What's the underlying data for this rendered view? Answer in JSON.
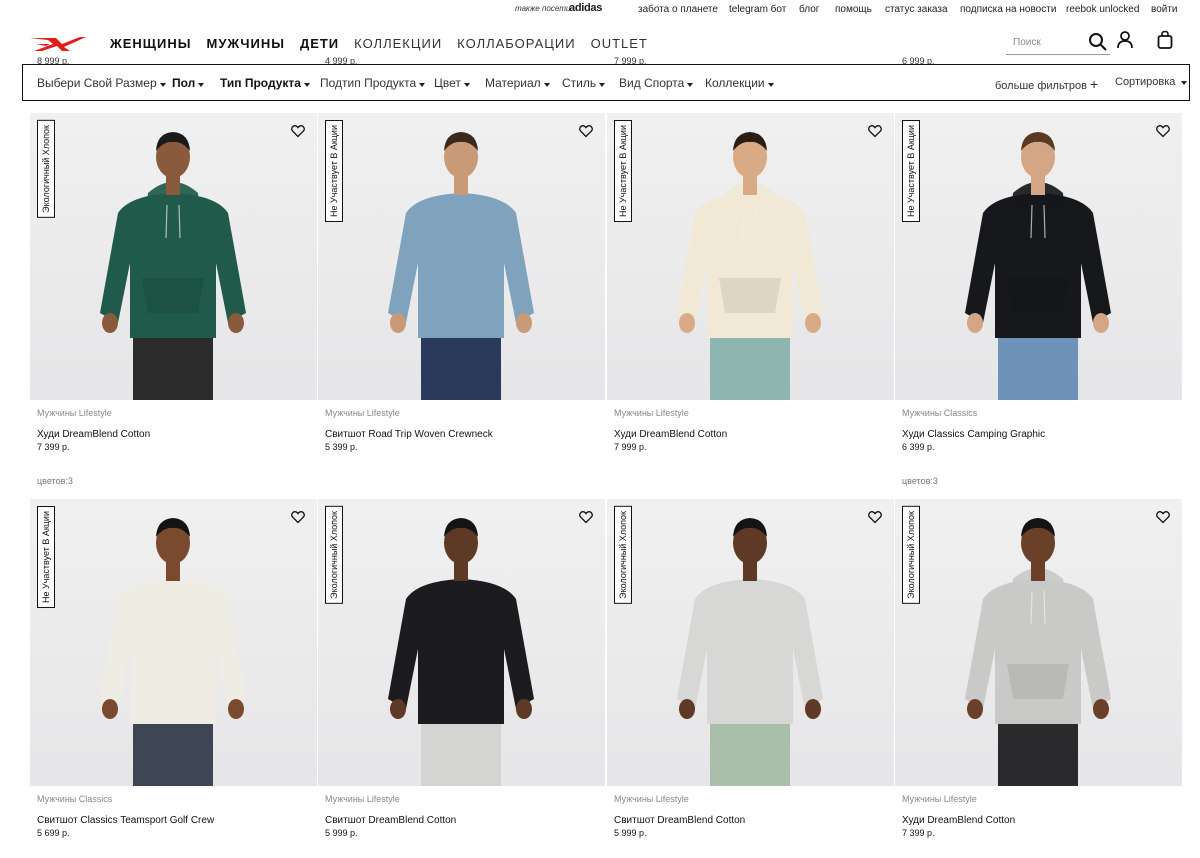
{
  "utility_bar": {
    "also_visit": "также посети",
    "adidas": "adidas",
    "links": [
      "забота о планете",
      "telegram бот",
      "блог",
      "помощь",
      "статус заказа",
      "подписка на новости",
      "reebok unlocked",
      "войти"
    ]
  },
  "header": {
    "nav": [
      {
        "label": "ЖЕНЩИНЫ",
        "bold": true
      },
      {
        "label": "МУЖЧИНЫ",
        "bold": true
      },
      {
        "label": "ДЕТИ",
        "bold": true
      },
      {
        "label": "КОЛЛЕКЦИИ",
        "bold": false
      },
      {
        "label": "КОЛЛАБОРАЦИИ",
        "bold": false
      },
      {
        "label": "OUTLET",
        "bold": false
      }
    ],
    "search_placeholder": "Поиск",
    "ghost_prices": [
      "8 999 р.",
      "4 999 р.",
      "7 999 р.",
      "6 999 р."
    ]
  },
  "filters": {
    "items": [
      {
        "label": "Выбери Свой Размер",
        "bold": false
      },
      {
        "label": "Пол",
        "bold": true
      },
      {
        "label": "Тип Продукта",
        "bold": true
      },
      {
        "label": "Подтип Продукта",
        "bold": false
      },
      {
        "label": "Цвет",
        "bold": false
      },
      {
        "label": "Материал",
        "bold": false
      },
      {
        "label": "Стиль",
        "bold": false
      },
      {
        "label": "Вид Спорта",
        "bold": false
      },
      {
        "label": "Коллекции",
        "bold": false
      }
    ],
    "more_filters": "больше фильтров",
    "more_icon": "+",
    "sort": "Сортировка"
  },
  "products": [
    {
      "badge": "Экологичный Хлопок",
      "category": "Мужчины Lifestyle",
      "name": "Худи DreamBlend Cotton",
      "price": "7 399 р.",
      "colors": "цветов:3",
      "top_color": "#1f5a4a",
      "bottom_color": "#2b2b2b",
      "top_type": "hoodie",
      "skin": "#8a5a3c",
      "hair": "#1a1a1a"
    },
    {
      "badge": "Не Участвует В Акции",
      "category": "Мужчины Lifestyle",
      "name": "Свитшот Road Trip Woven Crewneck",
      "price": "5 399 р.",
      "colors": "",
      "top_color": "#7fa3bd",
      "bottom_color": "#2a3a5c",
      "top_type": "crew",
      "skin": "#c89a78",
      "hair": "#3a2a1e"
    },
    {
      "badge": "Не Участвует В Акции",
      "category": "Мужчины Lifestyle",
      "name": "Худи DreamBlend Cotton",
      "price": "7 999 р.",
      "colors": "",
      "top_color": "#f1e8d6",
      "bottom_color": "#8fb5b0",
      "top_type": "hoodie",
      "skin": "#d8ab86",
      "hair": "#2a1e14"
    },
    {
      "badge": "Не Участвует В Акции",
      "category": "Мужчины Classics",
      "name": "Худи Classics Camping Graphic",
      "price": "6 399 р.",
      "colors": "цветов:3",
      "top_color": "#17181c",
      "bottom_color": "#6f93b8",
      "top_type": "hoodie",
      "skin": "#d4a686",
      "hair": "#5a3a22"
    },
    {
      "badge": "Не Участвует В Акции",
      "category": "Мужчины Classics",
      "name": "Свитшот Classics Teamsport Golf Crew",
      "price": "5 699 р.",
      "colors": "",
      "top_color": "#efece4",
      "bottom_color": "#3e4654",
      "top_type": "crew",
      "skin": "#7a4a2e",
      "hair": "#141414"
    },
    {
      "badge": "Экологичный Хлопок",
      "category": "Мужчины Lifestyle",
      "name": "Свитшот DreamBlend Cotton",
      "price": "5 999 р.",
      "colors": "",
      "top_color": "#1c1c20",
      "bottom_color": "#d4d4d2",
      "top_type": "crew",
      "skin": "#5e3a26",
      "hair": "#141414"
    },
    {
      "badge": "Экологичный Хлопок",
      "category": "Мужчины Lifestyle",
      "name": "Свитшот DreamBlend Cotton",
      "price": "5 999 р.",
      "colors": "",
      "top_color": "#d7d7d5",
      "bottom_color": "#a9bfaa",
      "top_type": "crew",
      "skin": "#5e3a26",
      "hair": "#141414"
    },
    {
      "badge": "Экологичный Хлопок",
      "category": "Мужчины Lifestyle",
      "name": "Худи DreamBlend Cotton",
      "price": "7 399 р.",
      "colors": "",
      "top_color": "#c9c9c7",
      "bottom_color": "#2a2a2c",
      "top_type": "hoodie",
      "skin": "#6a4028",
      "hair": "#141414"
    }
  ],
  "colors": {
    "brand_red": "#e41d1b",
    "border": "#111111",
    "muted_text": "#888888"
  }
}
